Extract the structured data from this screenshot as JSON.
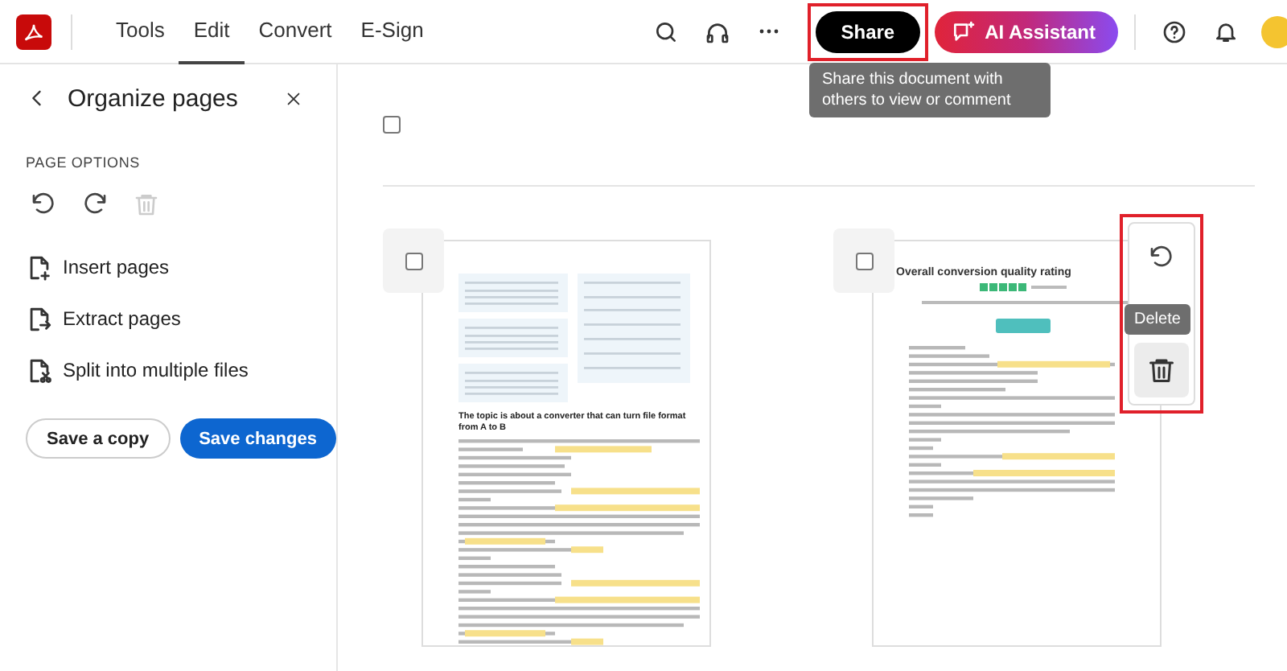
{
  "app_bar": {
    "nav": [
      {
        "label": "Tools",
        "selected": false
      },
      {
        "label": "Edit",
        "selected": true
      },
      {
        "label": "Convert",
        "selected": false
      },
      {
        "label": "E-Sign",
        "selected": false
      }
    ],
    "share": {
      "label": "Share",
      "highlighted": true,
      "tooltip": "Share this document with others to view or comment"
    },
    "assistant": {
      "label": "AI Assistant"
    }
  },
  "panel": {
    "title": "Organize pages",
    "section": "PAGE OPTIONS",
    "page_actions": [
      {
        "kind": "undo",
        "disabled": false
      },
      {
        "kind": "redo",
        "disabled": false
      },
      {
        "kind": "delete",
        "disabled": true
      }
    ],
    "items": [
      {
        "kind": "insert",
        "label": "Insert pages"
      },
      {
        "kind": "extract",
        "label": "Extract pages"
      },
      {
        "kind": "split",
        "label": "Split into multiple files"
      }
    ],
    "buttons": [
      {
        "kind": "secondary",
        "label": "Save a copy"
      },
      {
        "kind": "primary",
        "label": "Save changes"
      }
    ]
  },
  "pages": {
    "select_all_checked": false,
    "items": [
      {
        "kind": "article",
        "heading": "The topic is about a converter that can turn file format from A to B",
        "checked": false
      },
      {
        "kind": "rating",
        "heading": "Overall conversion quality rating",
        "checked": false,
        "toolbar": {
          "highlighted": true,
          "tooltip": "Delete"
        }
      }
    ]
  }
}
